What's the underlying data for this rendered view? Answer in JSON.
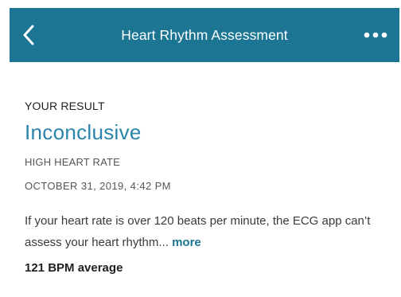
{
  "header": {
    "title": "Heart Rhythm Assessment",
    "back_icon": "chevron-left-icon",
    "more_icon": "ellipsis-icon",
    "background_color": "#1b7593"
  },
  "result": {
    "label": "YOUR RESULT",
    "value": "Inconclusive",
    "value_color": "#2a84ab",
    "category": "HIGH HEART RATE",
    "datetime": "OCTOBER 31, 2019, 4:42 PM",
    "description": "If your heart rate is over 120 beats per minute, the ECG app can’t assess your heart rhythm...",
    "more_label": "more",
    "average": "121 BPM average"
  }
}
